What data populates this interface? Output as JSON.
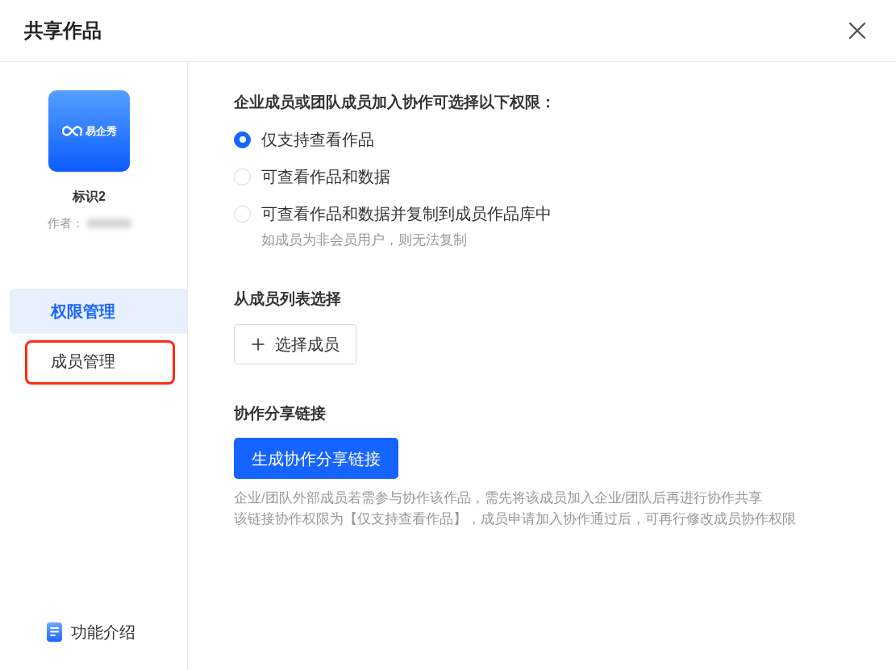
{
  "dialog": {
    "title": "共享作品"
  },
  "work": {
    "logo_text": "易企秀",
    "name": "标识2",
    "author_label": "作者：",
    "author_blurred": true
  },
  "sidebar": {
    "items": [
      {
        "label": "权限管理",
        "selected": true,
        "highlighted": false
      },
      {
        "label": "成员管理",
        "selected": false,
        "highlighted": true
      }
    ],
    "footer_link": "功能介绍"
  },
  "permissions": {
    "heading": "企业成员或团队成员加入协作可选择以下权限：",
    "options": [
      {
        "label": "仅支持查看作品",
        "selected": true
      },
      {
        "label": "可查看作品和数据",
        "selected": false
      },
      {
        "label": "可查看作品和数据并复制到成员作品库中",
        "selected": false,
        "note": "如成员为非会员用户，则无法复制"
      }
    ]
  },
  "member_list": {
    "heading": "从成员列表选择",
    "button": "选择成员"
  },
  "share_link": {
    "heading": "协作分享链接",
    "button": "生成协作分享链接",
    "notes": [
      "企业/团队外部成员若需参与协作该作品，需先将该成员加入企业/团队后再进行协作共享",
      "该链接协作权限为【仅支持查看作品】，成员申请加入协作通过后，可再行修改成员协作权限"
    ]
  }
}
